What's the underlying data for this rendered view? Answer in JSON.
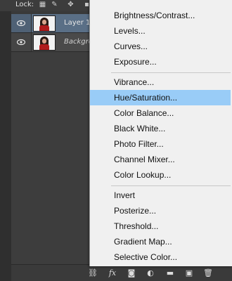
{
  "lockbar": {
    "label": "Lock:"
  },
  "layers": [
    {
      "name": "Layer 1",
      "selected": true
    },
    {
      "name": "Backgro",
      "selected": false
    }
  ],
  "menu": {
    "items": [
      {
        "label": "Brightness/Contrast..."
      },
      {
        "label": "Levels..."
      },
      {
        "label": "Curves..."
      },
      {
        "label": "Exposure..."
      },
      {
        "label": "Vibrance..."
      },
      {
        "label": "Hue/Saturation...",
        "highlighted": true
      },
      {
        "label": "Color Balance..."
      },
      {
        "label": "Black  White..."
      },
      {
        "label": "Photo Filter..."
      },
      {
        "label": "Channel Mixer..."
      },
      {
        "label": "Color Lookup..."
      },
      {
        "label": "Invert"
      },
      {
        "label": "Posterize..."
      },
      {
        "label": "Threshold..."
      },
      {
        "label": "Gradient Map..."
      },
      {
        "label": "Selective Color..."
      }
    ]
  },
  "toolbar": {
    "icons": [
      "link-icon",
      "fx-icon",
      "mask-icon",
      "adjustment-icon",
      "folder-icon",
      "new-layer-icon",
      "trash-icon"
    ],
    "fx_label": "fx"
  },
  "colors": {
    "menu_highlight": "#99ccf7",
    "selected_layer": "#5a6f86",
    "panel_bg": "#393939"
  }
}
